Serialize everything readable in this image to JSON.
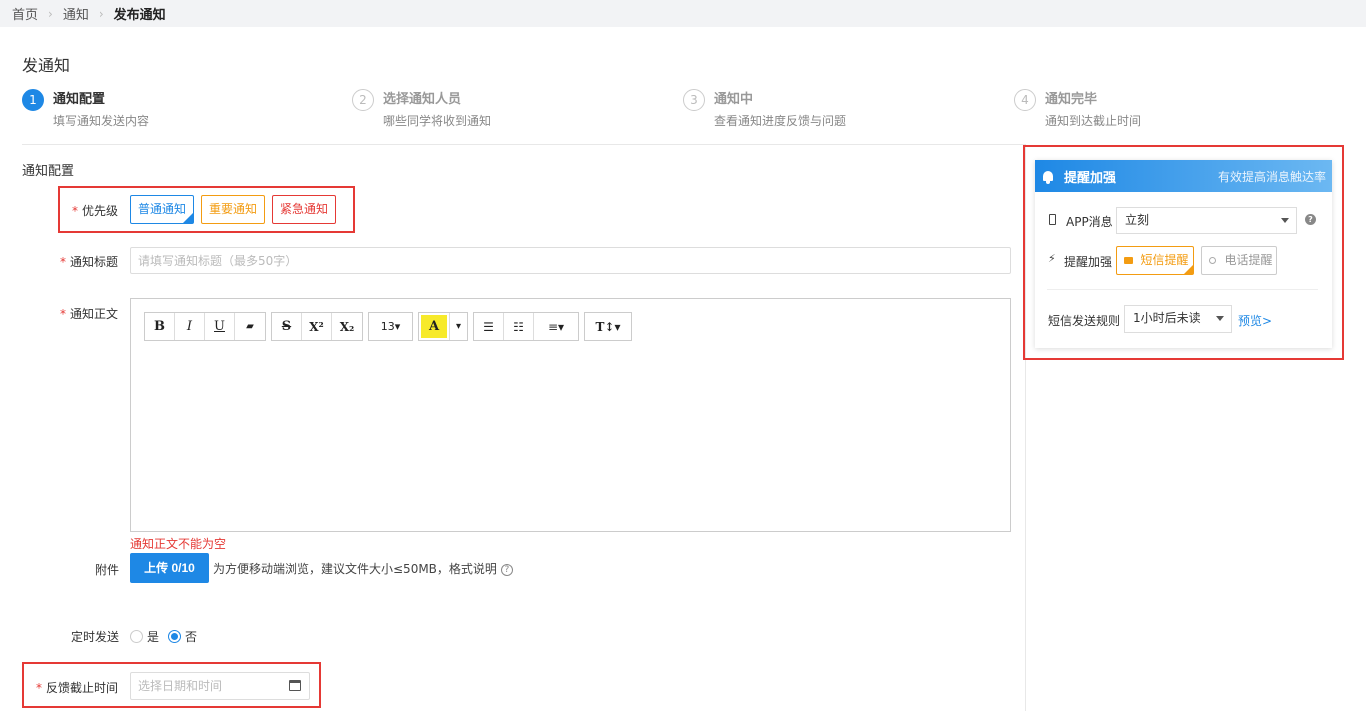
{
  "breadcrumb": {
    "home": "首页",
    "notice": "通知",
    "current": "发布通知"
  },
  "page_title": "发通知",
  "steps": [
    {
      "num": "1",
      "title": "通知配置",
      "desc": "填写通知发送内容"
    },
    {
      "num": "2",
      "title": "选择通知人员",
      "desc": "哪些同学将收到通知"
    },
    {
      "num": "3",
      "title": "通知中",
      "desc": "查看通知进度反馈与问题"
    },
    {
      "num": "4",
      "title": "通知完毕",
      "desc": "通知到达截止时间"
    }
  ],
  "form": {
    "section_title": "通知配置",
    "required_mark": "*",
    "priority": {
      "label": "优先级",
      "options": [
        "普通通知",
        "重要通知",
        "紧急通知"
      ],
      "selected": "普通通知",
      "colors": {
        "normal": "#1e88e5",
        "important": "#f39c12",
        "urgent": "#e53935"
      }
    },
    "title": {
      "label": "通知标题",
      "placeholder": "请填写通知标题（最多50字）",
      "value": ""
    },
    "body": {
      "label": "通知正文",
      "error": "通知正文不能为空",
      "font_size": "13"
    },
    "attachment": {
      "label": "附件",
      "button": "上传 0/10",
      "hint": "为方便移动端浏览，建议文件大小≤50MB，格式说明"
    },
    "schedule": {
      "label": "定时发送",
      "yes": "是",
      "no": "否",
      "selected": "否"
    },
    "deadline": {
      "label": "反馈截止时间",
      "placeholder": "选择日期和时间",
      "value": ""
    }
  },
  "toolbar": {
    "bold": "B",
    "italic": "I",
    "underline": "U",
    "eraser": "▰",
    "strike": "S",
    "sup": "X²",
    "sub": "X₂",
    "font_size": "13▾",
    "color": "A",
    "color_drop": "▾",
    "ul": "☰",
    "ol": "☷",
    "align": "≡▾",
    "typo": "T↕▾"
  },
  "reminder": {
    "title": "提醒加强",
    "subtitle": "有效提高消息触达率",
    "app_label": "APP消息",
    "app_value": "立刻",
    "enhance_label": "提醒加强",
    "sms_button": "短信提醒",
    "phone_button": "电话提醒",
    "sms_rule_label": "短信发送规则",
    "sms_rule_value": "1小时后未读",
    "preview": "预览>"
  },
  "icons": {
    "breadcrumb_sep": "chevron-right-icon",
    "bell": "bell-icon",
    "phone": "mobile-icon",
    "bolt": "lightning-icon",
    "help": "question-icon",
    "calendar": "calendar-icon"
  }
}
